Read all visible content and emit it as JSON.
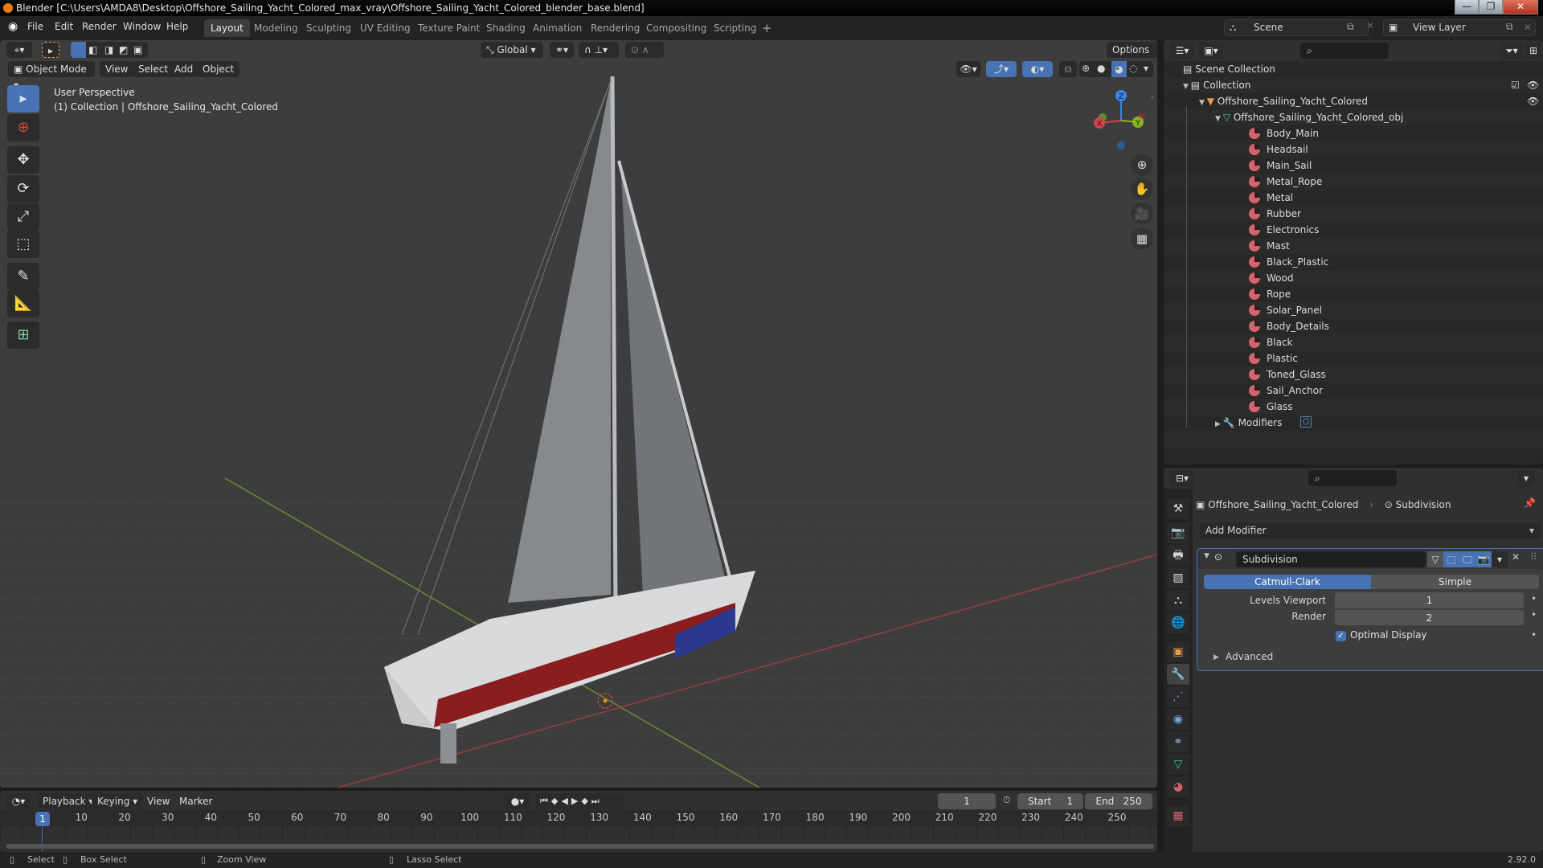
{
  "window": {
    "title": "Blender [C:\\Users\\AMDA8\\Desktop\\Offshore_Sailing_Yacht_Colored_max_vray\\Offshore_Sailing_Yacht_Colored_blender_base.blend]",
    "minimize": "—",
    "maximize": "❐",
    "close": "✕"
  },
  "menu": [
    "File",
    "Edit",
    "Render",
    "Window",
    "Help"
  ],
  "workspaces": [
    "Layout",
    "Modeling",
    "Sculpting",
    "UV Editing",
    "Texture Paint",
    "Shading",
    "Animation",
    "Rendering",
    "Compositing",
    "Scripting"
  ],
  "workspace_add": "+",
  "scene": {
    "name": "Scene",
    "view_layer": "View Layer"
  },
  "viewport": {
    "mode": "Object Mode",
    "menus": [
      "View",
      "Select",
      "Add",
      "Object"
    ],
    "transform_orientation": "Global",
    "options_label": "Options",
    "overlay_line1": "User Perspective",
    "overlay_line2": "(1) Collection | Offshore_Sailing_Yacht_Colored",
    "gizmo": {
      "x": "X",
      "y": "Y",
      "z": "Z"
    },
    "colors": {
      "x_axis": "#d2414f",
      "y_axis": "#86b41d",
      "z_axis": "#3b86e6",
      "active": "#4772b3"
    }
  },
  "outliner": {
    "scene_collection": "Scene Collection",
    "collection": "Collection",
    "object": "Offshore_Sailing_Yacht_Colored",
    "mesh": "Offshore_Sailing_Yacht_Colored_obj",
    "materials": [
      "Body_Main",
      "Headsail",
      "Main_Sail",
      "Metal_Rope",
      "Metal",
      "Rubber",
      "Electronics",
      "Mast",
      "Black_Plastic",
      "Wood",
      "Rope",
      "Solar_Panel",
      "Body_Details",
      "Black",
      "Plastic",
      "Toned_Glass",
      "Sail_Anchor",
      "Glass"
    ],
    "modifiers": "Modifiers"
  },
  "properties": {
    "breadcrumb_object": "Offshore_Sailing_Yacht_Colored",
    "breadcrumb_modifier": "Subdivision",
    "add_modifier": "Add Modifier",
    "modifier_name": "Subdivision",
    "type_options": [
      "Catmull-Clark",
      "Simple"
    ],
    "selected_type": "Catmull-Clark",
    "levels_viewport_label": "Levels Viewport",
    "levels_viewport": "1",
    "render_label": "Render",
    "render": "2",
    "optimal_display_label": "Optimal Display",
    "optimal_display": true,
    "advanced": "Advanced"
  },
  "timeline": {
    "menus": [
      "Playback",
      "Keying",
      "View",
      "Marker"
    ],
    "current_frame": "1",
    "start_label": "Start",
    "start": "1",
    "end_label": "End",
    "end": "250",
    "ticks": [
      "10",
      "20",
      "30",
      "40",
      "50",
      "60",
      "70",
      "80",
      "90",
      "100",
      "110",
      "120",
      "130",
      "140",
      "150",
      "160",
      "170",
      "180",
      "190",
      "200",
      "210",
      "220",
      "230",
      "240",
      "250"
    ]
  },
  "statusbar": {
    "select": "Select",
    "box_select": "Box Select",
    "zoom_view": "Zoom View",
    "lasso_select": "Lasso Select",
    "version": "2.92.0"
  }
}
